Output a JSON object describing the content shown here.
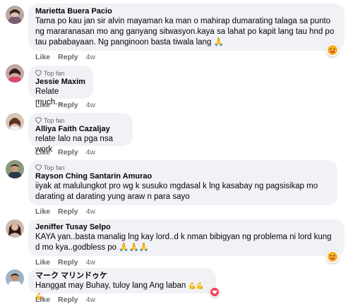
{
  "comments": [
    {
      "author": "Marietta Buera Pacio",
      "badge": "",
      "text": "Tama po kau jan sir alvin mayaman ka man o mahirap dumarating talaga sa punto ng mararanasan mo ang ganyang sitwasyon.kaya sa lahat po kapit lang tau hnd po tau pababayaan. Ng panginoon basta tiwala lang",
      "emoji": "🙏",
      "like": "Like",
      "reply": "Reply",
      "time": "4w",
      "reaction": "care-emoji"
    },
    {
      "author": "Jessie Maxim",
      "badge": "Top fan",
      "text": "Relate much...",
      "like": "Like",
      "reply": "Reply",
      "time": "4w"
    },
    {
      "author": "Alliya Faith Cazaljay",
      "badge": "Top fan",
      "text": "relate lalo na pga nsa work",
      "like": "Like",
      "reply": "Reply",
      "time": "4w"
    },
    {
      "author": "Rayson Ching Santarin Amurao",
      "badge": "Top fan",
      "text": "iiyak at malulungkot pro wg k susuko mgdasal k lng kasabay ng pagsisikap mo darating at darating yung araw n para sayo",
      "like": "Like",
      "reply": "Reply",
      "time": "4w"
    },
    {
      "author": "Jeniffer Tusay Selpo",
      "badge": "",
      "text": "KAYA yan..basta manalig lng kay lord..d k nman bibigyan ng problema ni lord kung d mo kya..godbless po",
      "emoji": "🙏🙏🙏",
      "like": "Like",
      "reply": "Reply",
      "time": "4w",
      "reaction": "care-emoji"
    },
    {
      "author": "マーク マリンドゥケ",
      "badge": "",
      "text": "Hanggat may Buhay, tuloy lang Ang laban",
      "emoji": "💪💪💪",
      "like": "Like",
      "reply": "Reply",
      "time": "4w",
      "reaction": "heart"
    }
  ],
  "colors": {
    "bubble": "#f0f2f5",
    "meta": "#65676b",
    "heart": "#f33e58",
    "care": "#f7b125"
  }
}
